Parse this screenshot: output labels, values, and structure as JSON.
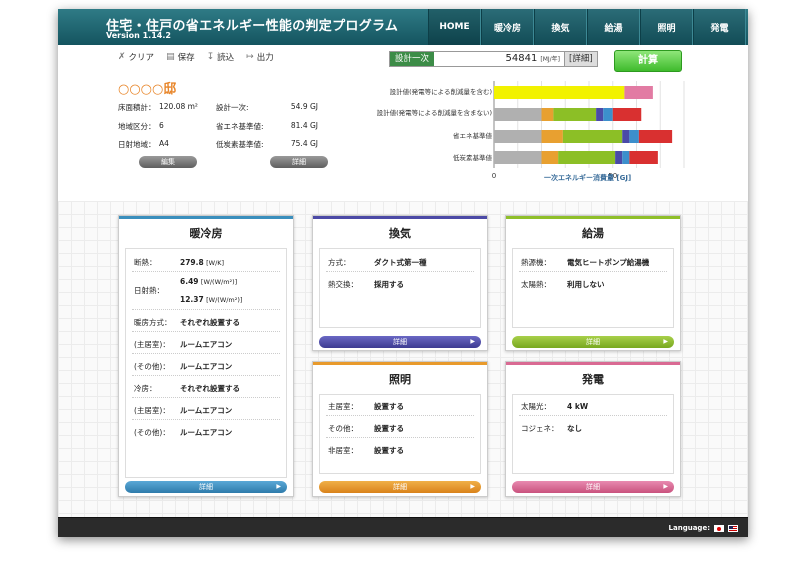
{
  "header": {
    "title": "住宅・住戸の省エネルギー性能の判定プログラム",
    "version": "Version 1.14.2",
    "tabs": [
      "HOME",
      "暖冷房",
      "換気",
      "給湯",
      "照明",
      "発電"
    ]
  },
  "toolbar": {
    "clear": "クリア",
    "save": "保存",
    "load": "読込",
    "output": "出力",
    "design_label": "設計一次",
    "design_value": "54841",
    "design_unit": "[MJ/年]",
    "detail": "[詳細]",
    "calc": "計算"
  },
  "house": {
    "name": "○○○○邸",
    "floor_area_label": "床面積計：",
    "floor_area_value": "120.08 m²",
    "region_label": "地域区分：",
    "region_value": "6",
    "sun_label": "日射地域：",
    "sun_value": "A4",
    "design_label": "設計一次:",
    "design_value": "54.9 GJ",
    "standard_label": "省エネ基準値:",
    "standard_value": "81.4 GJ",
    "lowcarbon_label": "低炭素基準値:",
    "lowcarbon_value": "75.4 GJ",
    "edit_button": "編集",
    "detail_button": "詳細"
  },
  "chart_data": {
    "type": "bar",
    "orientation": "horizontal",
    "stacked": true,
    "categories": [
      "設計値(発電等による削減量を含む)",
      "設計値(発電等による削減量を含まない)",
      "省エネ基準値",
      "低炭素基準値"
    ],
    "segments": [
      [
        {
          "value": 54.9,
          "color": "#f2f200"
        },
        {
          "value": 12.0,
          "color": "#e27ba3"
        }
      ],
      [
        {
          "value": 20.0,
          "color": "#b0b0b0"
        },
        {
          "value": 5.0,
          "color": "#e8a030"
        },
        {
          "value": 18.0,
          "color": "#8cbf26"
        },
        {
          "value": 3.0,
          "color": "#4a4aa8"
        },
        {
          "value": 4.0,
          "color": "#3c8fcc"
        },
        {
          "value": 12.0,
          "color": "#d93030"
        }
      ],
      [
        {
          "value": 20.0,
          "color": "#b0b0b0"
        },
        {
          "value": 9.0,
          "color": "#e8a030"
        },
        {
          "value": 25.0,
          "color": "#8cbf26"
        },
        {
          "value": 3.0,
          "color": "#4a4aa8"
        },
        {
          "value": 4.0,
          "color": "#3c8fcc"
        },
        {
          "value": 14.0,
          "color": "#d93030"
        }
      ],
      [
        {
          "value": 20.0,
          "color": "#b0b0b0"
        },
        {
          "value": 7.0,
          "color": "#e8a030"
        },
        {
          "value": 24.0,
          "color": "#8cbf26"
        },
        {
          "value": 3.0,
          "color": "#4a4aa8"
        },
        {
          "value": 3.0,
          "color": "#3c8fcc"
        },
        {
          "value": 12.0,
          "color": "#d93030"
        }
      ]
    ],
    "xlim": [
      0,
      80
    ],
    "xticks": [
      0,
      50
    ],
    "xlabel": "一次エネルギー消費量 [GJ]",
    "grid": true
  },
  "panels": {
    "heating": {
      "title": "暖冷房",
      "rows": [
        {
          "label": "断熱：",
          "value": "279.8",
          "unit": "[W/K]"
        },
        {
          "label": "日射熱：",
          "value": "6.49",
          "unit": "[W/(W/m²)]"
        },
        {
          "label": "",
          "value": "12.37",
          "unit": "[W/(W/m²)]"
        },
        {
          "label": "暖房方式：",
          "value": "それぞれ設置する"
        },
        {
          "label": "(主居室)：",
          "value": "ルームエアコン"
        },
        {
          "label": "(その他)：",
          "value": "ルームエアコン"
        },
        {
          "label": "冷房：",
          "value": "それぞれ設置する"
        },
        {
          "label": "(主居室)：",
          "value": "ルームエアコン"
        },
        {
          "label": "(その他)：",
          "value": "ルームエアコン"
        }
      ],
      "detail": "詳細",
      "color": "#3b8fbd"
    },
    "ventilation": {
      "title": "換気",
      "rows": [
        {
          "label": "方式：",
          "value": "ダクト式第一種"
        },
        {
          "label": "熱交換：",
          "value": "採用する"
        }
      ],
      "detail": "詳細",
      "color": "#4c4aa6"
    },
    "hotwater": {
      "title": "給湯",
      "rows": [
        {
          "label": "熱源機：",
          "value": "電気ヒートポンプ給湯機"
        },
        {
          "label": "太陽熱：",
          "value": "利用しない"
        }
      ],
      "detail": "詳細",
      "color": "#8fbf2a"
    },
    "lighting": {
      "title": "照明",
      "rows": [
        {
          "label": "主居室：",
          "value": "設置する"
        },
        {
          "label": "その他：",
          "value": "設置する"
        },
        {
          "label": "非居室：",
          "value": "設置する"
        }
      ],
      "detail": "詳細",
      "color": "#e89a2c"
    },
    "generation": {
      "title": "発電",
      "rows": [
        {
          "label": "太陽光：",
          "value": "4 kW"
        },
        {
          "label": "コジェネ：",
          "value": "なし"
        }
      ],
      "detail": "詳細",
      "color": "#d96a93"
    }
  },
  "footer": {
    "language": "Language:"
  }
}
